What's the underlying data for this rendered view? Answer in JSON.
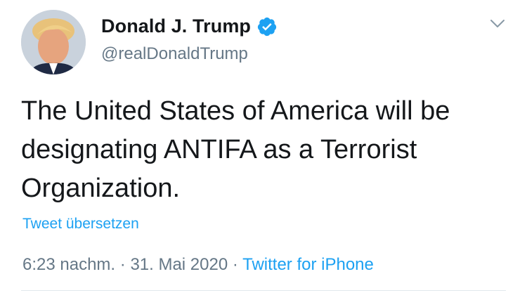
{
  "author": {
    "display_name": "Donald J. Trump",
    "handle": "@realDonaldTrump",
    "verified": true,
    "avatar_icon": "profile-photo"
  },
  "tweet": {
    "text": "The United States of America will be designating ANTIFA as a Terrorist Organization.",
    "translate_label": "Tweet übersetzen"
  },
  "meta": {
    "time": "6:23 nachm.",
    "separator": "·",
    "date": "31. Mai 2020",
    "source": "Twitter for iPhone"
  },
  "colors": {
    "accent": "#1da1f2",
    "text": "#14171a",
    "secondary": "#657786",
    "divider": "#e1e8ed"
  },
  "icons": {
    "verified": "verified-badge-icon",
    "menu": "chevron-down-icon"
  }
}
